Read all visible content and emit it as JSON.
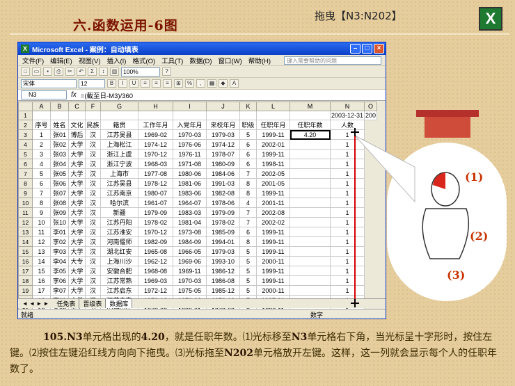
{
  "slide": {
    "title": "六.函数运用-6图",
    "subtitle": "拖曳【N3:N202】",
    "logo_text": "X",
    "step_labels": [
      "(1)",
      "(2)",
      "(3)"
    ],
    "description": [
      "105.",
      "N3",
      "单元格出现的",
      "4.20",
      "，就是任职年数。⑴光标移至",
      "N3",
      "单元格右下角，当光标呈十字形时，按住左键。⑵按住左键沿红线方向向下拖曳。⑶光标拖至",
      "N202",
      "单元格放开左键。这样，这一列就会显示每个人的任职年数了。"
    ],
    "colors": {
      "background": "#e6cd9d",
      "title": "#7a1200",
      "drag_line": "#d40000",
      "step_label": "#c83200"
    }
  },
  "excel": {
    "window_title": "Microsoft Excel - 案例：自动填表",
    "help_placeholder": "键入需要帮助的问题",
    "menu": [
      "文件(F)",
      "编辑(E)",
      "视图(V)",
      "插入(I)",
      "格式(O)",
      "工具(T)",
      "数据(D)",
      "窗口(W)",
      "帮助(H)"
    ],
    "font_name": "宋体",
    "font_size": "12",
    "zoom": "100%",
    "name_box": "N3",
    "fx_label": "fx",
    "formula": "=(截至日-M3)/360",
    "column_headers": [
      "A",
      "B",
      "C",
      "F",
      "G",
      "H",
      "I",
      "J",
      "K",
      "L",
      "M",
      "N",
      "O"
    ],
    "row1": {
      "N": "2003-12-31",
      "O": "200"
    },
    "header_row": [
      "序号",
      "姓名",
      "文化",
      "民族",
      "籍贯",
      "工作年月",
      "入党年月",
      "来校年月",
      "职级",
      "任职年月",
      "任职年数",
      "人数"
    ],
    "rows": [
      [
        "1",
        "张01",
        "博后",
        "汉",
        "江苏吴县",
        "1969-02",
        "1970-03",
        "1979-03",
        "5",
        "1999-11",
        "4.20",
        "1"
      ],
      [
        "2",
        "张02",
        "大学",
        "汉",
        "上海松江",
        "1974-12",
        "1976-06",
        "1974-12",
        "6",
        "2002-01",
        "",
        "1"
      ],
      [
        "3",
        "张03",
        "大学",
        "汉",
        "浙江上虞",
        "1970-12",
        "1976-11",
        "1978-07",
        "6",
        "1999-11",
        "",
        "1"
      ],
      [
        "4",
        "张04",
        "大学",
        "汉",
        "浙江宁波",
        "1968-03",
        "1971-08",
        "1980-09",
        "6",
        "1998-11",
        "",
        "1"
      ],
      [
        "5",
        "张05",
        "大学",
        "汉",
        "上海市",
        "1977-08",
        "1980-06",
        "1984-06",
        "7",
        "2002-05",
        "",
        "1"
      ],
      [
        "6",
        "张06",
        "大学",
        "汉",
        "江苏吴县",
        "1978-12",
        "1981-06",
        "1991-03",
        "8",
        "2001-05",
        "",
        "1"
      ],
      [
        "7",
        "张07",
        "大学",
        "汉",
        "江苏南京",
        "1980-07",
        "1983-06",
        "1982-08",
        "8",
        "1999-11",
        "",
        "1"
      ],
      [
        "8",
        "张08",
        "大学",
        "汉",
        "哈尔滨",
        "1961-07",
        "1964-07",
        "1978-06",
        "4",
        "2001-11",
        "",
        "1"
      ],
      [
        "9",
        "张09",
        "大学",
        "汉",
        "新疆",
        "1979-09",
        "1983-03",
        "1979-09",
        "7",
        "2002-08",
        "",
        "1"
      ],
      [
        "10",
        "张10",
        "大学",
        "汉",
        "江苏丹阳",
        "1978-02",
        "1981-04",
        "1978-02",
        "7",
        "2002-02",
        "",
        "1"
      ],
      [
        "11",
        "李01",
        "大学",
        "汉",
        "江苏淮安",
        "1970-12",
        "1973-08",
        "1985-09",
        "6",
        "1999-11",
        "",
        "1"
      ],
      [
        "12",
        "李02",
        "大学",
        "汉",
        "河南偃师",
        "1982-09",
        "1984-09",
        "1994-01",
        "8",
        "1999-11",
        "",
        "1"
      ],
      [
        "13",
        "李03",
        "大学",
        "汉",
        "湖北红安",
        "1965-08",
        "1966-05",
        "1979-03",
        "5",
        "1999-11",
        "",
        "1"
      ],
      [
        "14",
        "李04",
        "大专",
        "汉",
        "上海川沙",
        "1962-12",
        "1969-06",
        "1993-10",
        "5",
        "2000-11",
        "",
        "1"
      ],
      [
        "15",
        "李05",
        "大学",
        "汉",
        "安徽合肥",
        "1968-08",
        "1969-11",
        "1986-12",
        "5",
        "1999-11",
        "",
        "1"
      ],
      [
        "16",
        "李06",
        "大学",
        "汉",
        "江苏常熟",
        "1969-03",
        "1970-03",
        "1986-08",
        "5",
        "1999-11",
        "",
        "1"
      ],
      [
        "17",
        "李07",
        "大学",
        "汉",
        "江苏启东",
        "1972-12",
        "1975-05",
        "1985-12",
        "5",
        "2000-11",
        "",
        "1"
      ],
      [
        "18",
        "李08",
        "大学",
        "汉",
        "江苏启东",
        "1973-12",
        "1976-02",
        "1973-12",
        "7",
        "1997-01",
        "",
        "1"
      ],
      [
        "19",
        "李09",
        "大专",
        "汉",
        "安徽安庆",
        "1978-02",
        "1980-01",
        "1978-02",
        "8",
        "1999-11",
        "",
        "1"
      ],
      [
        "20",
        "李10",
        "大学",
        "汉",
        "安徽巢湖",
        "1979-11",
        "1984-12",
        "1979-11",
        "8",
        "2001-02",
        "",
        "1"
      ]
    ],
    "sheet_tabs": [
      "任免表",
      "晋级表",
      "数据库"
    ],
    "active_tab": 2,
    "status_left": "就绪",
    "status_right": "数字"
  }
}
